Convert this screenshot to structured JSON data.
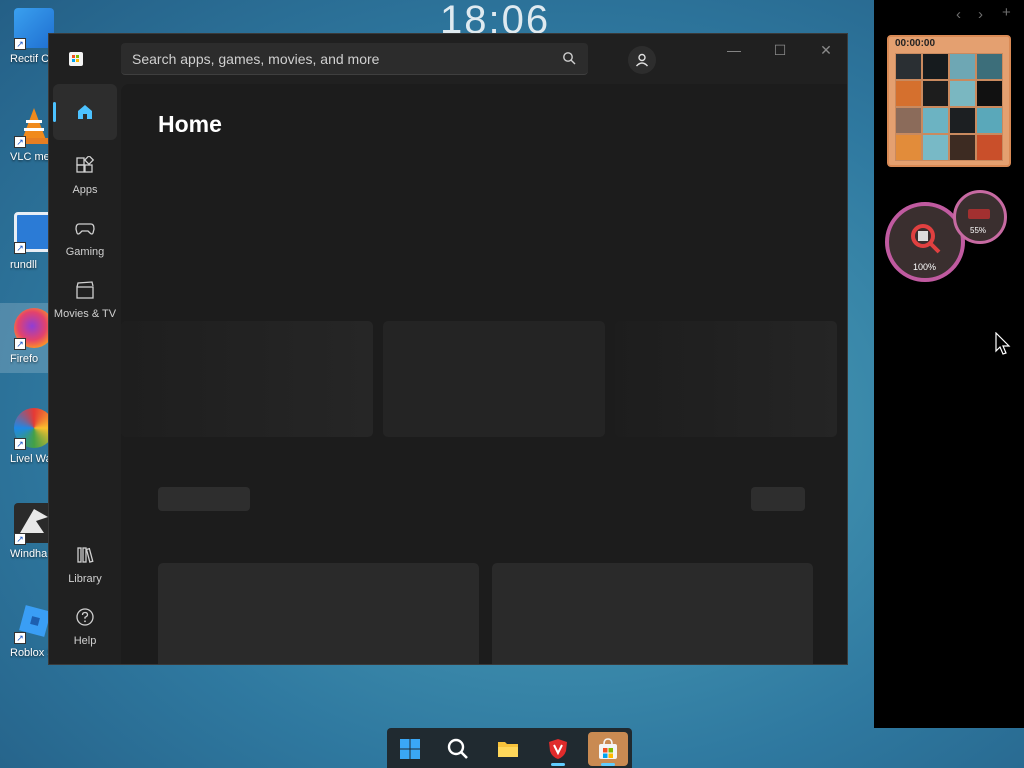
{
  "desktop": {
    "clock": "18:06",
    "icons": [
      {
        "label": "Rectif Contro"
      },
      {
        "label": "VLC me playe"
      },
      {
        "label": "rundll"
      },
      {
        "label": "Firefo"
      },
      {
        "label": "Livel Wallpa"
      },
      {
        "label": "Windha"
      },
      {
        "label": "Roblox S"
      }
    ]
  },
  "store": {
    "search_placeholder": "Search apps, games, movies, and more",
    "nav": [
      {
        "label": ""
      },
      {
        "label": "Apps"
      },
      {
        "label": "Gaming"
      },
      {
        "label": "Movies & TV"
      },
      {
        "label": "Library"
      },
      {
        "label": "Help"
      }
    ],
    "page_title": "Home",
    "window_buttons": {
      "minimize": "—",
      "maximize": "☐",
      "close": "✕"
    }
  },
  "widgets": {
    "puzzle_timer": "00:00:00",
    "meter_large": "100%",
    "meter_small": "55%",
    "panel_controls": {
      "back": "‹",
      "forward": "›",
      "add": "+"
    }
  },
  "colors": {
    "accent": "#4cc2ff",
    "window_bg": "#202020",
    "content_bg": "#1c1c1c",
    "taskbar_active": "#c98a52"
  }
}
